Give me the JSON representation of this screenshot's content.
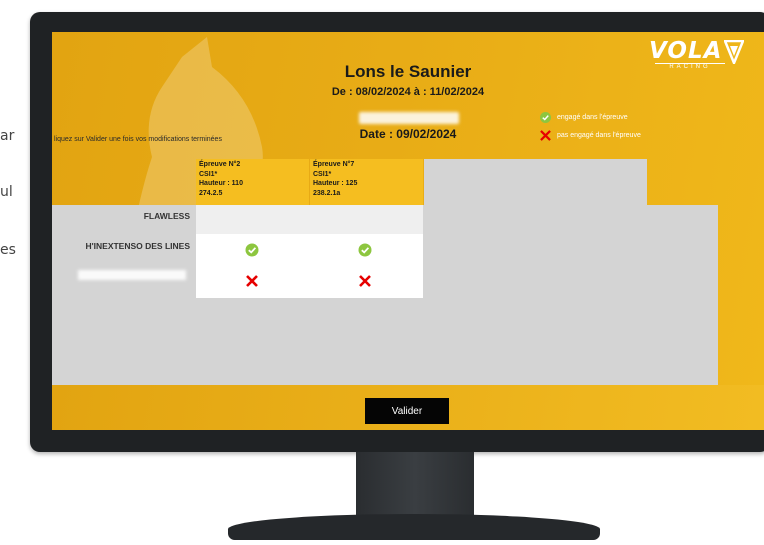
{
  "page": {
    "side_fragments": [
      "ar",
      "ul",
      "es"
    ]
  },
  "screen": {
    "logo": {
      "brand": "VOLA",
      "sub": "RACING"
    },
    "title": "Lons le Saunier",
    "dates": "De : 08/02/2024 à : 11/02/2024",
    "date": "Date : 09/02/2024",
    "instruction": "liquez sur Valider une fois vos modifications terminées",
    "legend": [
      {
        "icon": "check-icon",
        "label": "engagé dans l'épreuve",
        "color": "#8dc63f"
      },
      {
        "icon": "cross-icon",
        "label": "pas engagé dans l'épreuve",
        "color": "#e60000"
      }
    ],
    "columns": [
      {
        "line1": "Épreuve N°2",
        "line2": "CSI1*",
        "line3": "Hauteur : 110",
        "line4": "274.2.5"
      },
      {
        "line1": "Épreuve N°7",
        "line2": "CSI1*",
        "line3": "Hauteur : 125",
        "line4": "238.2.1a"
      }
    ],
    "rows": [
      {
        "label": "FLAWLESS",
        "marks": [
          "",
          ""
        ]
      },
      {
        "label": "H'INEXTENSO DES LINES",
        "marks": [
          "check-icon",
          "check-icon"
        ]
      },
      {
        "label": "",
        "marks": [
          "cross-icon",
          "cross-icon"
        ]
      }
    ],
    "submit_label": "Valider"
  },
  "colors": {
    "gold": "#e8ac16",
    "column_gold": "#f5be20",
    "check": "#8dc63f",
    "cross": "#e60000"
  }
}
